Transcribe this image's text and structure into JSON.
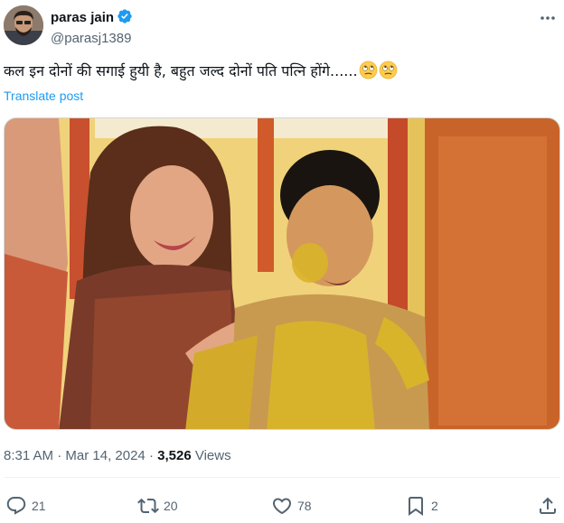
{
  "user": {
    "display_name": "paras jain",
    "handle": "@parasj1389",
    "verified": true,
    "avatar": "avatar-photo"
  },
  "tweet": {
    "text": "कल इन दोनों की सगाई हुयी है, बहुत जल्द दोनों पति पत्नि होंगे......",
    "emojis": [
      "face-with-rolling-eyes-emoji",
      "face-with-rolling-eyes-emoji"
    ],
    "translate_label": "Translate post",
    "media": "photo-haldi-ceremony"
  },
  "meta": {
    "time": "8:31 AM",
    "separator": "·",
    "date": "Mar 14, 2024",
    "views_count": "3,526",
    "views_label": "Views"
  },
  "actions": {
    "replies": "21",
    "reposts": "20",
    "likes": "78",
    "bookmarks": "2"
  },
  "colors": {
    "accent": "#1d9bf0",
    "secondary_text": "#536471",
    "primary_text": "#0f1419"
  }
}
